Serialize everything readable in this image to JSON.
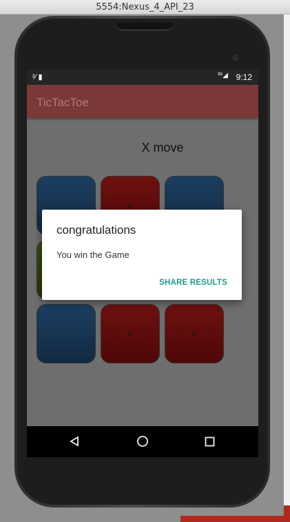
{
  "window": {
    "title": "5554:Nexus_4_API_23"
  },
  "statusbar": {
    "left_icons": "²⁄ ▮",
    "network": "³⁶◢",
    "battery": "▮",
    "time": "9:12"
  },
  "app": {
    "title": "TicTacToe",
    "status_text": "X move"
  },
  "board": {
    "cells": [
      {
        "label": "",
        "color": "blue"
      },
      {
        "label": "o",
        "color": "red"
      },
      {
        "label": "",
        "color": "blue"
      },
      {
        "label": "",
        "color": "green"
      },
      {
        "label": "",
        "color": "red"
      },
      {
        "label": "",
        "color": "blue"
      },
      {
        "label": "",
        "color": "blue"
      },
      {
        "label": "o",
        "color": "red"
      },
      {
        "label": "o",
        "color": "red"
      }
    ]
  },
  "dialog": {
    "title": "congratulations",
    "message": "You win the Game",
    "button": "SHARE RESULTS"
  },
  "navbar": {
    "back": "back-icon",
    "home": "home-icon",
    "recents": "recents-icon"
  },
  "colors": {
    "appbar": "#7a3838",
    "accent": "#1e9a8a",
    "x_tile": "#1c3e5f",
    "o_tile": "#6e1010",
    "green_tile": "#3a4d10"
  }
}
